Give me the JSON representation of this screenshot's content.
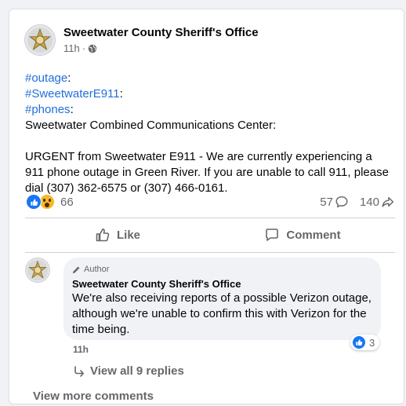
{
  "post": {
    "page_name": "Sweetwater County Sheriff's Office",
    "time": "11h",
    "separator": "·",
    "privacy_icon": "globe-icon",
    "avatar_icon": "sheriff-star-badge",
    "tags": [
      {
        "tag": "#outage",
        "suffix": ":"
      },
      {
        "tag": "#SweetwaterE911",
        "suffix": ":"
      },
      {
        "tag": "#phones",
        "suffix": ":"
      }
    ],
    "lead": "Sweetwater Combined Communications Center:",
    "body": "URGENT from Sweetwater E911 - We are currently experiencing a 911 phone outage in Green River. If you are unable to call 911, please dial (307) 362-6575 or (307) 466-0161."
  },
  "stats": {
    "reaction_icons": [
      "like-icon",
      "wow-icon"
    ],
    "reaction_count": "66",
    "comment_count": "57",
    "share_count": "140"
  },
  "actions": {
    "like_label": "Like",
    "comment_label": "Comment"
  },
  "comment": {
    "badge": "Author",
    "author": "Sweetwater County Sheriff's Office",
    "text": "We're also receiving reports of a possible Verizon outage, although we're unable to confirm this with Verizon for the time being.",
    "reaction_count": "3",
    "time": "11h"
  },
  "view_replies_label": "View all 9 replies",
  "view_more_label": "View more comments",
  "colors": {
    "accent": "#1877f2",
    "hashtag": "#216fdb",
    "muted": "#65676b",
    "bubble": "#f0f2f5"
  }
}
